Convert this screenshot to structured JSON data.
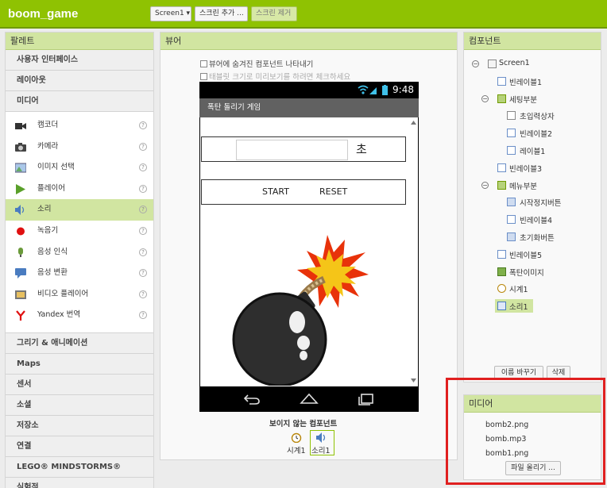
{
  "topbar": {
    "project_name": "boom_game",
    "screen_select": "Screen1 ▾",
    "add_screen": "스크린 추가 ...",
    "remove_screen": "스크린 제거"
  },
  "palette": {
    "title": "팔레트",
    "categories_top": [
      "사용자 인터페이스",
      "레이아웃",
      "미디어"
    ],
    "media_items": [
      {
        "label": "캠코더",
        "icon": "camcorder-icon"
      },
      {
        "label": "카메라",
        "icon": "camera-icon"
      },
      {
        "label": "이미지 선택",
        "icon": "image-picker-icon"
      },
      {
        "label": "플레이어",
        "icon": "player-icon"
      },
      {
        "label": "소리",
        "icon": "sound-icon",
        "selected": true
      },
      {
        "label": "녹음기",
        "icon": "recorder-icon"
      },
      {
        "label": "음성 인식",
        "icon": "speech-recognizer-icon"
      },
      {
        "label": "음성 변환",
        "icon": "text-to-speech-icon"
      },
      {
        "label": "비디오 플레이어",
        "icon": "video-player-icon"
      },
      {
        "label": "Yandex 번역",
        "icon": "yandex-icon"
      }
    ],
    "help_glyph": "?",
    "categories_bottom": [
      "그리기 & 애니메이션",
      "Maps",
      "센서",
      "소셜",
      "저장소",
      "연결",
      "LEGO® MINDSTORMS®",
      "실험적"
    ]
  },
  "viewer": {
    "title": "뷰어",
    "check_hidden": "뷰어에 숨겨진 컴포넌트 나타내기",
    "check_tablet": "태블릿 크기로 미리보기를 하려면 체크하세요",
    "phone_time": "9:48",
    "app_title": "폭탄 돌리기 게임",
    "unit_label": "초",
    "start_label": "START",
    "reset_label": "RESET",
    "nonvisible_title": "보이지 않는 컴포넌트",
    "nonvisible": [
      {
        "label": "시계1",
        "icon": "clock-icon"
      },
      {
        "label": "소리1",
        "icon": "sound-icon"
      }
    ]
  },
  "components": {
    "title": "컴포넌트",
    "tree": [
      {
        "label": "Screen1",
        "level": 0,
        "icon": "screen-icon",
        "toggle": "−"
      },
      {
        "label": "빈레이블1",
        "level": 1,
        "icon": "label-icon"
      },
      {
        "label": "세팅부분",
        "level": 1,
        "icon": "arrangement-icon",
        "toggle": "−"
      },
      {
        "label": "초입력상자",
        "level": 2,
        "icon": "textbox-icon"
      },
      {
        "label": "빈레이블2",
        "level": 2,
        "icon": "label-icon"
      },
      {
        "label": "레이블1",
        "level": 2,
        "icon": "label-icon"
      },
      {
        "label": "빈레이블3",
        "level": 1,
        "icon": "label-icon"
      },
      {
        "label": "메뉴부분",
        "level": 1,
        "icon": "arrangement-icon",
        "toggle": "−"
      },
      {
        "label": "시작정지버튼",
        "level": 2,
        "icon": "button-icon"
      },
      {
        "label": "빈레이블4",
        "level": 2,
        "icon": "label-icon"
      },
      {
        "label": "초기화버튼",
        "level": 2,
        "icon": "button-icon"
      },
      {
        "label": "빈레이블5",
        "level": 1,
        "icon": "label-icon"
      },
      {
        "label": "폭탄이미지",
        "level": 1,
        "icon": "image-icon"
      },
      {
        "label": "시계1",
        "level": 1,
        "icon": "clock-icon"
      },
      {
        "label": "소리1",
        "level": 1,
        "icon": "sound-icon",
        "selected": true
      }
    ],
    "rename_button": "이름 바꾸기",
    "delete_button": "삭제"
  },
  "media": {
    "title": "미디어",
    "files": [
      "bomb2.png",
      "bomb.mp3",
      "bomb1.png"
    ],
    "upload_button": "파일 올리기 ..."
  },
  "colors": {
    "accent": "#8fc202",
    "panel_header": "#d1e5a1",
    "highlight_box": "#e02020"
  }
}
